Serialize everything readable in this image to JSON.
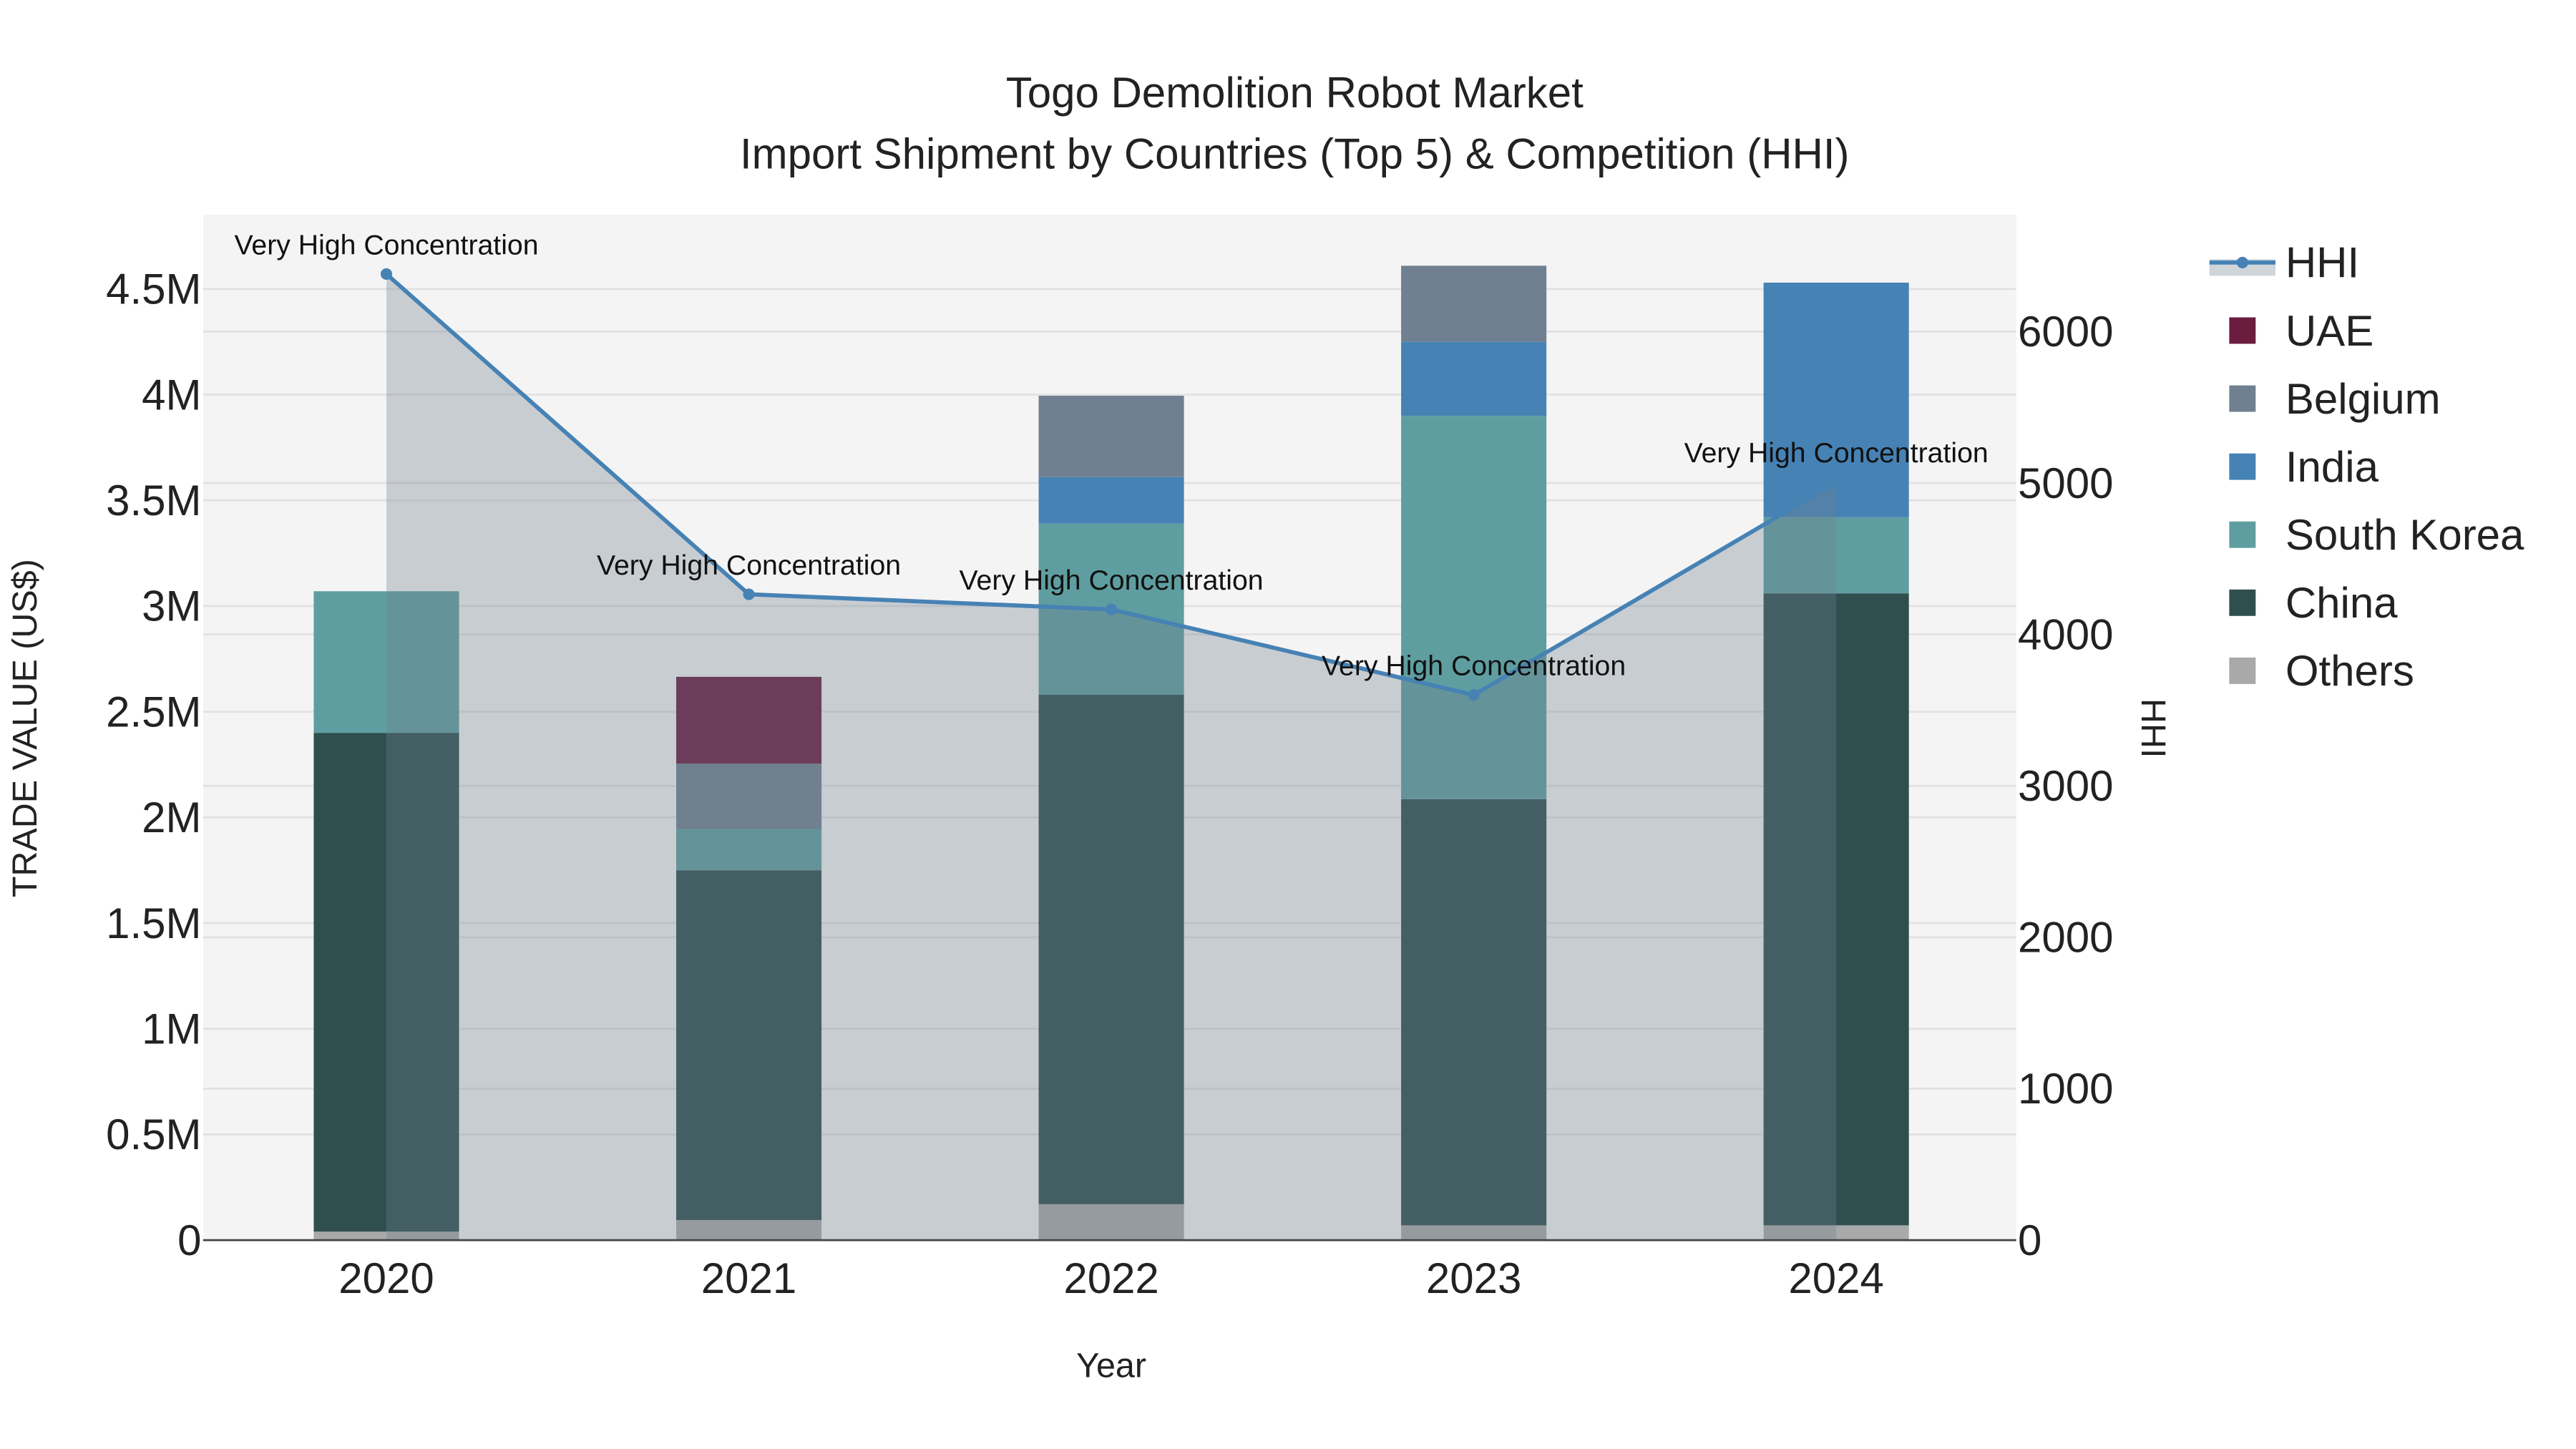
{
  "chart_data": {
    "type": "bar",
    "title": "Togo Demolition Robot Market",
    "subtitle": "Import Shipment by Countries (Top 5) & Competition (HHI)",
    "xlabel": "Year",
    "ylabel": "TRADE VALUE (US$)",
    "y2label": "HHI",
    "categories": [
      "2020",
      "2021",
      "2022",
      "2023",
      "2024"
    ],
    "ylim": [
      0,
      4800000
    ],
    "y2lim": [
      0,
      6750
    ],
    "yticks": [
      0,
      500000,
      1000000,
      1500000,
      2000000,
      2500000,
      3000000,
      3500000,
      4000000,
      4500000
    ],
    "ytick_labels": [
      "0",
      "0.5M",
      "1M",
      "1.5M",
      "2M",
      "2.5M",
      "3M",
      "3.5M",
      "4M",
      "4.5M"
    ],
    "y2ticks": [
      0,
      1000,
      2000,
      3000,
      4000,
      5000,
      6000
    ],
    "y2tick_labels": [
      "0",
      "1000",
      "2000",
      "3000",
      "4000",
      "5000",
      "6000"
    ],
    "stacked": true,
    "series": [
      {
        "name": "Others",
        "color": "#A9A9A9",
        "values": [
          40000,
          95000,
          170000,
          70000,
          70000
        ]
      },
      {
        "name": "China",
        "color": "#2F4F4F",
        "values": [
          2360000,
          1655000,
          2410000,
          2016000,
          2990000
        ]
      },
      {
        "name": "South Korea",
        "color": "#5F9EA0",
        "values": [
          670000,
          195000,
          810000,
          1814000,
          360000
        ]
      },
      {
        "name": "India",
        "color": "#4682B4",
        "values": [
          0,
          0,
          220000,
          350000,
          1110000
        ]
      },
      {
        "name": "Belgium",
        "color": "#708090",
        "values": [
          0,
          310000,
          385000,
          360000,
          0
        ]
      },
      {
        "name": "UAE",
        "color": "#6B1D40",
        "values": [
          0,
          410000,
          0,
          0,
          0
        ]
      }
    ],
    "hhi": {
      "name": "HHI",
      "color": "#4682B4",
      "values": [
        6380,
        4265,
        4165,
        3600,
        5005
      ]
    },
    "annotations": [
      "Very High Concentration",
      "Very High Concentration",
      "Very High Concentration",
      "Very High Concentration",
      "Very High Concentration"
    ],
    "legend": [
      "HHI",
      "UAE",
      "Belgium",
      "India",
      "South Korea",
      "China",
      "Others"
    ],
    "legend_position": "right",
    "grid": true
  }
}
